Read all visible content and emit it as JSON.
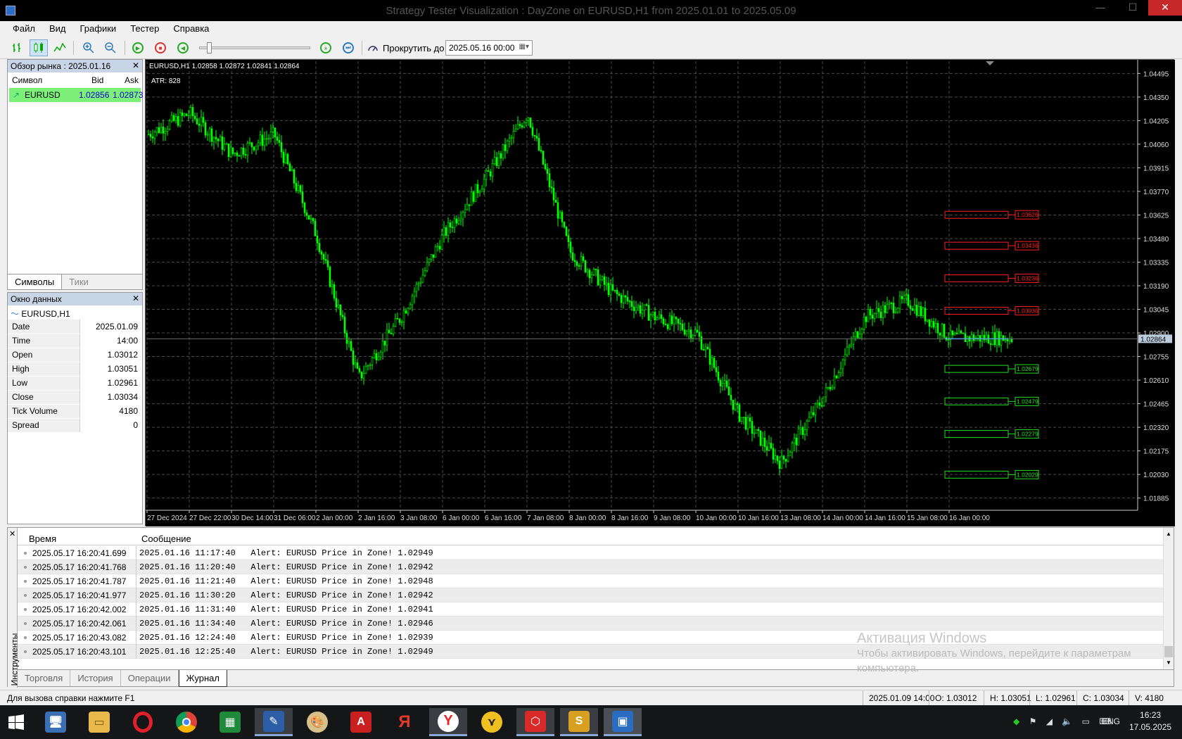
{
  "window": {
    "title": "Strategy Tester Visualization : DayZone on EURUSD,H1 from 2025.01.01 to 2025.05.09",
    "min": "—",
    "max": "☐",
    "close": "✕"
  },
  "menu": [
    "Файл",
    "Вид",
    "Графики",
    "Тестер",
    "Справка"
  ],
  "toolbar": {
    "scroll_label": "Прокрутить до",
    "scroll_date": "2025.05.16 00:00"
  },
  "market_watch": {
    "title": "Обзор рынка : 2025.01.16",
    "cols": [
      "Символ",
      "Bid",
      "Ask"
    ],
    "rows": [
      {
        "symbol": "EURUSD",
        "bid": "1.02856",
        "ask": "1.02873"
      }
    ],
    "tabs": [
      "Символы",
      "Тики"
    ]
  },
  "data_window": {
    "title": "Окно данных",
    "symbol": "EURUSD,H1",
    "rows": [
      {
        "k": "Date",
        "v": "2025.01.09"
      },
      {
        "k": "Time",
        "v": "14:00"
      },
      {
        "k": "Open",
        "v": "1.03012"
      },
      {
        "k": "High",
        "v": "1.03051"
      },
      {
        "k": "Low",
        "v": "1.02961"
      },
      {
        "k": "Close",
        "v": "1.03034"
      },
      {
        "k": "Tick Volume",
        "v": "4180"
      },
      {
        "k": "Spread",
        "v": "0"
      }
    ]
  },
  "chart": {
    "header": "EURUSD,H1  1.02858 1.02872 1.02841 1.02864",
    "indicator": "ATR: 828",
    "price_labels": [
      "1.04495",
      "1.04350",
      "1.04205",
      "1.04060",
      "1.03915",
      "1.03770",
      "1.03625",
      "1.03480",
      "1.03335",
      "1.03190",
      "1.03045",
      "1.02900",
      "1.02755",
      "1.02610",
      "1.02465",
      "1.02320",
      "1.02175",
      "1.02030",
      "1.01885"
    ],
    "current_price": "1.02864",
    "time_labels": [
      "27 Dec 2024",
      "27 Dec 22:00",
      "30 Dec 14:00",
      "31 Dec 06:00",
      "2 Jan 00:00",
      "2 Jan 16:00",
      "3 Jan 08:00",
      "6 Jan 00:00",
      "6 Jan 16:00",
      "7 Jan 08:00",
      "8 Jan 00:00",
      "8 Jan 16:00",
      "9 Jan 08:00",
      "10 Jan 00:00",
      "10 Jan 16:00",
      "13 Jan 08:00",
      "14 Jan 00:00",
      "14 Jan 16:00",
      "15 Jan 08:00",
      "16 Jan 00:00"
    ],
    "resistance_zones": [
      "1.03626",
      "1.03436",
      "1.03236",
      "1.03036"
    ],
    "support_zones": [
      "1.02679",
      "1.02479",
      "1.02279",
      "1.02029"
    ],
    "colors": {
      "bg": "#000000",
      "candle": "#00ff00",
      "grid": "#4a4a4a",
      "resistance": "#ff2020",
      "support": "#20e020",
      "price_line": "#5aa0d8"
    }
  },
  "chart_data": {
    "type": "line",
    "ylim": [
      1.0181,
      1.0457
    ],
    "x": [
      "27 Dec 2024",
      "27 Dec 22:00",
      "30 Dec 14:00",
      "31 Dec 06:00",
      "2 Jan 00:00",
      "2 Jan 16:00",
      "3 Jan 08:00",
      "6 Jan 00:00",
      "6 Jan 16:00",
      "7 Jan 08:00",
      "8 Jan 00:00",
      "8 Jan 16:00",
      "9 Jan 08:00",
      "10 Jan 00:00",
      "10 Jan 16:00",
      "13 Jan 08:00",
      "14 Jan 00:00",
      "14 Jan 16:00",
      "15 Jan 08:00",
      "16 Jan 00:00"
    ],
    "series": [
      {
        "values": [
          1.0412,
          1.0425,
          1.04,
          1.0412,
          1.035,
          1.0262,
          1.03,
          1.035,
          1.0385,
          1.0425,
          1.034,
          1.0315,
          1.03,
          1.029,
          1.024,
          1.021,
          1.025,
          1.03,
          1.031,
          1.0287
        ]
      }
    ]
  },
  "journal": {
    "cols": [
      "Время",
      "Сообщение"
    ],
    "rows": [
      {
        "t": "2025.05.17 16:20:41.699",
        "m": "2025.01.16 11:17:40   Alert: EURUSD Price in Zone! 1.02949"
      },
      {
        "t": "2025.05.17 16:20:41.768",
        "m": "2025.01.16 11:20:40   Alert: EURUSD Price in Zone! 1.02942"
      },
      {
        "t": "2025.05.17 16:20:41.787",
        "m": "2025.01.16 11:21:40   Alert: EURUSD Price in Zone! 1.02948"
      },
      {
        "t": "2025.05.17 16:20:41.977",
        "m": "2025.01.16 11:30:20   Alert: EURUSD Price in Zone! 1.02942"
      },
      {
        "t": "2025.05.17 16:20:42.002",
        "m": "2025.01.16 11:31:40   Alert: EURUSD Price in Zone! 1.02941"
      },
      {
        "t": "2025.05.17 16:20:42.061",
        "m": "2025.01.16 11:34:40   Alert: EURUSD Price in Zone! 1.02946"
      },
      {
        "t": "2025.05.17 16:20:43.082",
        "m": "2025.01.16 12:24:40   Alert: EURUSD Price in Zone! 1.02939"
      },
      {
        "t": "2025.05.17 16:20:43.101",
        "m": "2025.01.16 12:25:40   Alert: EURUSD Price in Zone! 1.02949"
      }
    ],
    "tabs": [
      "Торговля",
      "История",
      "Операции",
      "Журнал"
    ],
    "side_label": "Инструменты"
  },
  "watermark": {
    "title": "Активация Windows",
    "line1": "Чтобы активировать Windows, перейдите к параметрам",
    "line2": "компьютера."
  },
  "status": {
    "help": "Для вызова справки нажмите F1",
    "date": "2025.01.09 14:00",
    "open": "O: 1.03012",
    "high": "H: 1.03051",
    "low": "L: 1.02961",
    "close": "C: 1.03034",
    "volume": "V: 4180"
  },
  "taskbar": {
    "lang": "ENG",
    "time": "16:23",
    "date": "17.05.2025",
    "apps": [
      "start",
      "computer",
      "explorer",
      "opera",
      "chrome",
      "calculator",
      "notepad",
      "paint",
      "pdf",
      "yandex-browser",
      "yandex",
      "coin",
      "box",
      "app",
      "metatrader"
    ]
  }
}
